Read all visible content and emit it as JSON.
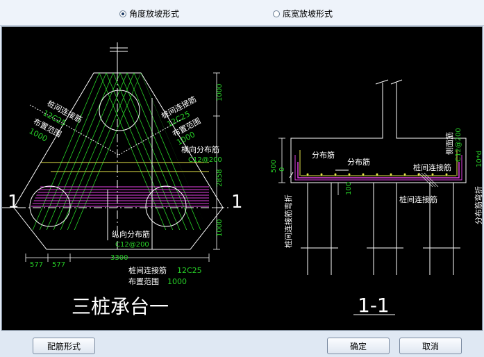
{
  "options": {
    "angle_mode": "角度放坡形式",
    "bottom_width_mode": "底宽放坡形式"
  },
  "drawing": {
    "plan_title": "三桩承台一",
    "section_title": "1-1",
    "section_mark": "1",
    "left_labels": {
      "pile_link_1": "桩间连接筋",
      "pile_link_1_spec": "12C25",
      "range_1": "布置范围",
      "range_1_value": "1000",
      "pile_link_2": "桩间连接筋",
      "pile_link_2_spec": "12C25",
      "range_2": "布置范围",
      "range_2_value": "1000",
      "transverse": "横向分布筋",
      "transverse_spec": "C12@200",
      "longitudinal": "纵向分布筋",
      "longitudinal_spec": "C12@200",
      "bottom_link": "桩间连接筋",
      "bottom_link_spec": "12C25",
      "bottom_range": "布置范围",
      "bottom_range_value": "1000"
    },
    "left_dims": {
      "d_top": "1000",
      "d_mid": "2858",
      "d_bottom": "1000",
      "d_left1": "577",
      "d_left2": "577",
      "d_width": "3300"
    },
    "section_labels": {
      "dist1": "分布筋",
      "dist2": "分布筋",
      "pile_link": "桩间连接筋",
      "pile_link_bottom": "桩间连接筋",
      "side_bar": "侧面筋",
      "side_spec": "C12@200",
      "bend": "分布筋弯折",
      "bend_value": "10*d",
      "pile_bend": "桩间连接筋弯折",
      "h500": "500",
      "h0": "0",
      "h100": "100"
    }
  },
  "buttons": {
    "rebar_form": "配筋形式",
    "ok": "确定",
    "cancel": "取消"
  }
}
